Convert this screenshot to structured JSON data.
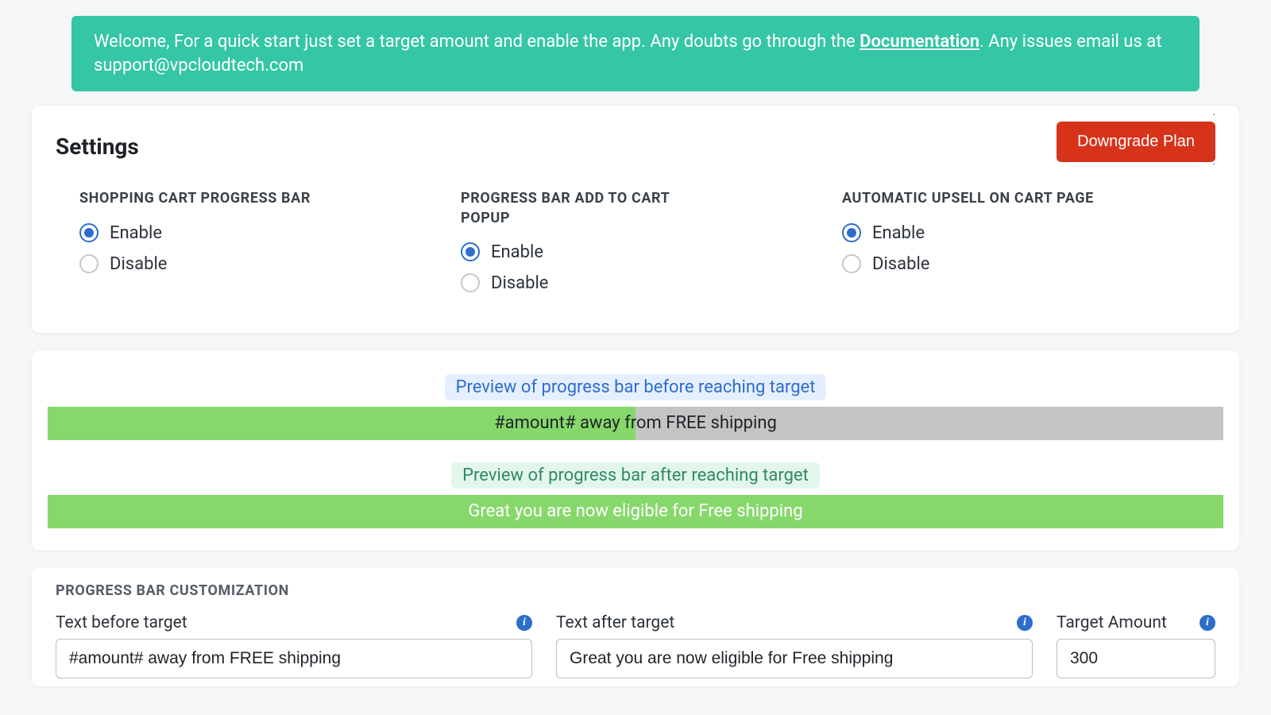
{
  "banner": {
    "text_before_link": "Welcome, For a quick start just set a target amount and enable the app. Any doubts go through the ",
    "link_text": "Documentation",
    "text_after_link": ". Any issues email us at support@vpcloudtech.com"
  },
  "settings": {
    "title": "Settings",
    "downgrade_label": "Downgrade Plan",
    "groups": [
      {
        "heading": "SHOPPING CART PROGRESS BAR",
        "enable_label": "Enable",
        "disable_label": "Disable",
        "selected": "enable"
      },
      {
        "heading": "PROGRESS BAR ADD TO CART POPUP",
        "enable_label": "Enable",
        "disable_label": "Disable",
        "selected": "enable"
      },
      {
        "heading": "AUTOMATIC UPSELL ON CART PAGE",
        "enable_label": "Enable",
        "disable_label": "Disable",
        "selected": "enable"
      }
    ]
  },
  "preview": {
    "before_label": "Preview of progress bar before reaching target",
    "before_text": "#amount# away from FREE shipping",
    "before_fill_percent": 50,
    "after_label": "Preview of progress bar after reaching target",
    "after_text": "Great you are now eligible for Free shipping"
  },
  "customization": {
    "heading": "PROGRESS BAR CUSTOMIZATION",
    "fields": {
      "text_before": {
        "label": "Text before target",
        "value": "#amount# away from FREE shipping"
      },
      "text_after": {
        "label": "Text after target",
        "value": "Great you are now eligible for Free shipping"
      },
      "target_amount": {
        "label": "Target Amount",
        "value": "300"
      }
    }
  }
}
